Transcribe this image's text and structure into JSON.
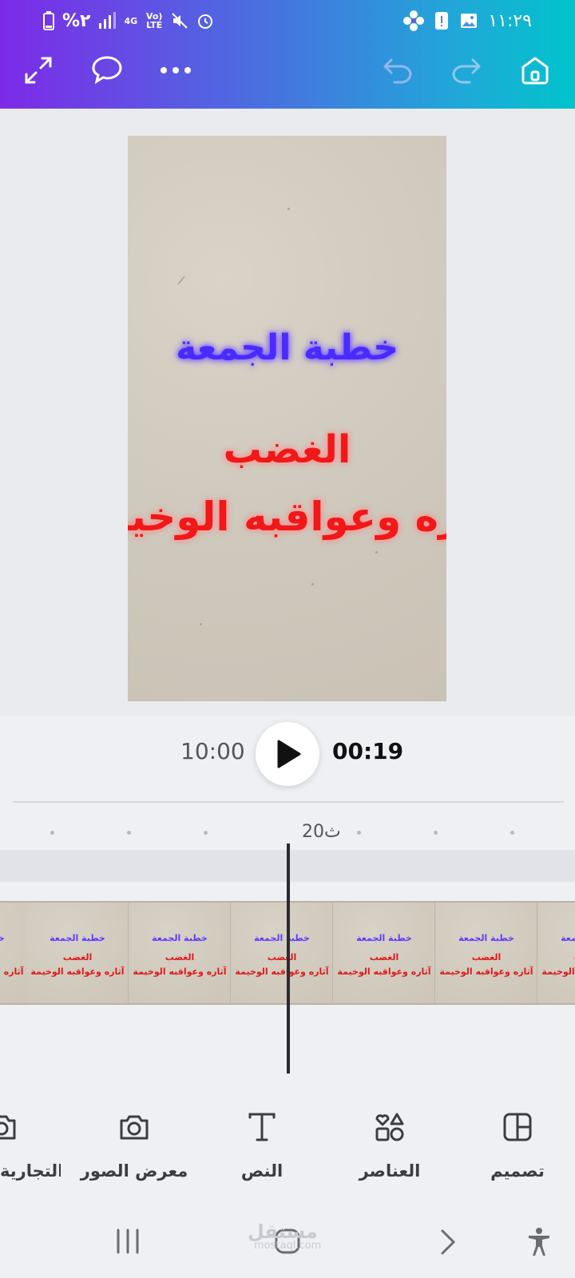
{
  "status_bar": {
    "time": "١١:٢٩",
    "battery": "%٢",
    "network": "4G",
    "volte": "Vo) LTE",
    "icons": [
      "battery-icon",
      "signal-icon",
      "data-icon",
      "volte-icon",
      "mute-icon",
      "alarm-icon",
      "settings-flower-icon",
      "alert-icon",
      "gallery-icon"
    ]
  },
  "toolbar": {
    "icons": [
      "expand-icon",
      "comment-icon",
      "more-icon",
      "undo-icon",
      "redo-icon",
      "home-icon"
    ],
    "accent_gradient": [
      "#7d2ae8",
      "#00c4cc"
    ]
  },
  "canvas": {
    "title_line": "خطبة الجمعة",
    "subtitle_line": "الغضب",
    "body_line": "آثاره وعواقبه الوخيمة"
  },
  "playback": {
    "total_time": "10:00",
    "current_time": "00:19",
    "ruler_label": "20ث"
  },
  "filmstrip": {
    "frame_line1": "خطبة الجمعة",
    "frame_line2": "الغضب",
    "frame_line3": "آثاره وعواقبه الوخيمة"
  },
  "tools": [
    {
      "label": "تصميم",
      "icon": "design-icon"
    },
    {
      "label": "العناصر",
      "icon": "elements-icon"
    },
    {
      "label": "النص",
      "icon": "text-icon"
    },
    {
      "label": "معرض الصور",
      "icon": "camera-icon"
    },
    {
      "label": "العلامة التجارية",
      "icon": "brand-icon"
    }
  ],
  "watermark": {
    "main": "مستقل",
    "sub": "mostaql.com"
  }
}
